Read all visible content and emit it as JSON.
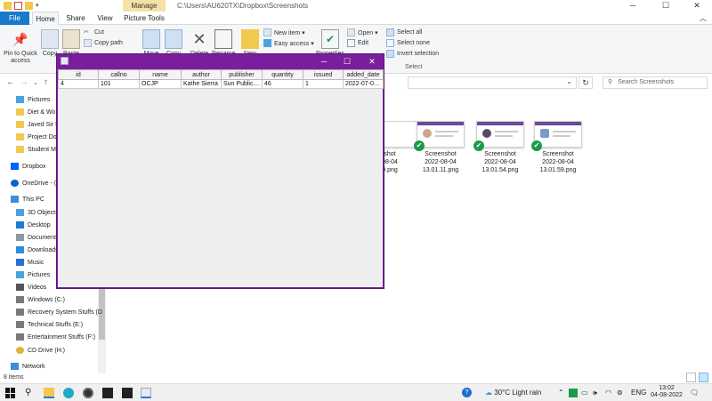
{
  "window": {
    "path": "C:\\Users\\AU620TX\\Dropbox\\Screenshots",
    "manage_label": "Manage",
    "minimize": "─",
    "maximize": "☐",
    "close": "✕"
  },
  "ribbon_tabs": [
    "File",
    "Home",
    "Share",
    "View",
    "Picture Tools"
  ],
  "ribbon": {
    "pin": "Pin to Quick access",
    "copy": "Copy",
    "paste": "Paste",
    "cut": "Cut",
    "copy_path": "Copy path",
    "move": "Move",
    "copy_to": "Copy",
    "delete": "Delete",
    "rename": "Rename",
    "new": "New",
    "new_item": "New item ▾",
    "easy_access": "Easy access ▾",
    "properties": "Properties",
    "open": "Open ▾",
    "edit": "Edit",
    "select_all": "Select all",
    "select_none": "Select none",
    "invert_selection": "Invert selection",
    "select_group": "Select"
  },
  "search": {
    "placeholder": "Search Screenshots"
  },
  "nav_items": [
    {
      "label": "Pictures",
      "icon": "pictures-icon",
      "color": "#4aa3df"
    },
    {
      "label": "Diet & Wo",
      "icon": "folder-icon",
      "color": "#f2c94c"
    },
    {
      "label": "Javed Sir N",
      "icon": "folder-icon",
      "color": "#f2c94c"
    },
    {
      "label": "Project Do",
      "icon": "folder-icon",
      "color": "#f2c94c"
    },
    {
      "label": "Student M",
      "icon": "folder-icon",
      "color": "#f2c94c"
    },
    {
      "label": "Dropbox",
      "icon": "dropbox-icon",
      "color": "#0061fe"
    },
    {
      "label": "OneDrive - (",
      "icon": "cloud-icon",
      "color": "#0a64c8"
    },
    {
      "label": "This PC",
      "icon": "pc-icon",
      "color": "#3b8fd6"
    },
    {
      "label": "3D Objects",
      "icon": "cube-icon",
      "color": "#4aa3df"
    },
    {
      "label": "Desktop",
      "icon": "desktop-icon",
      "color": "#1f7ad6"
    },
    {
      "label": "Documents",
      "icon": "documents-icon",
      "color": "#8c9aa8"
    },
    {
      "label": "Downloads",
      "icon": "download-icon",
      "color": "#2a8fe0"
    },
    {
      "label": "Music",
      "icon": "music-icon",
      "color": "#2a6fd6"
    },
    {
      "label": "Pictures",
      "icon": "pictures-icon",
      "color": "#4aa3df"
    },
    {
      "label": "Videos",
      "icon": "video-icon",
      "color": "#555555"
    },
    {
      "label": "Windows (C:)",
      "icon": "drive-icon",
      "color": "#7a7a7a"
    },
    {
      "label": "Recovery System Stuffs (D",
      "icon": "drive-icon",
      "color": "#7a7a7a"
    },
    {
      "label": "Technical Stuffs (E:)",
      "icon": "drive-icon",
      "color": "#7a7a7a"
    },
    {
      "label": "Entertainment Stuffs (F:)",
      "icon": "drive-icon",
      "color": "#7a7a7a"
    },
    {
      "label": "CD Drive (H:)",
      "icon": "cd-icon",
      "color": "#e2b33c"
    },
    {
      "label": "Network",
      "icon": "network-icon",
      "color": "#3b8fd6"
    }
  ],
  "status": {
    "items": "8 items"
  },
  "files": [
    {
      "name": "Screenshot 2022-08-04 13.01.11.png",
      "l1": "Screenshot",
      "l2": "2022-08-04",
      "l3": "13.01.11.png"
    },
    {
      "name": "Screenshot 2022-08-04 13.01.54.png",
      "l1": "Screenshot",
      "l2": "2022-08-04",
      "l3": "13.01.54.png"
    },
    {
      "name": "Screenshot 2022-08-04 13.01.59.png",
      "l1": "Screenshot",
      "l2": "2022-08-04",
      "l3": "13.01.59.png"
    }
  ],
  "partial_file": {
    "l1": "shot",
    "l2": "08-04",
    "l3": "0.png"
  },
  "java_window": {
    "minimize": "─",
    "maximize": "☐",
    "close": "✕",
    "columns": [
      "id",
      "callno",
      "name",
      "author",
      "publisher",
      "quantity",
      "issued",
      "added_date"
    ],
    "rows": [
      [
        "4",
        "101",
        "OCJP",
        "Kathe Sierra",
        "Sun Publica...",
        "46",
        "1",
        "2022-07-06..."
      ]
    ]
  },
  "taskbar": {
    "weather": "30°C  Light rain",
    "lang": "ENG",
    "time": "13:02",
    "date": "04-08-2022"
  },
  "colors": {
    "accent": "#1979ca",
    "java_frame": "#7b1e9e",
    "check": "#1a9b48"
  }
}
